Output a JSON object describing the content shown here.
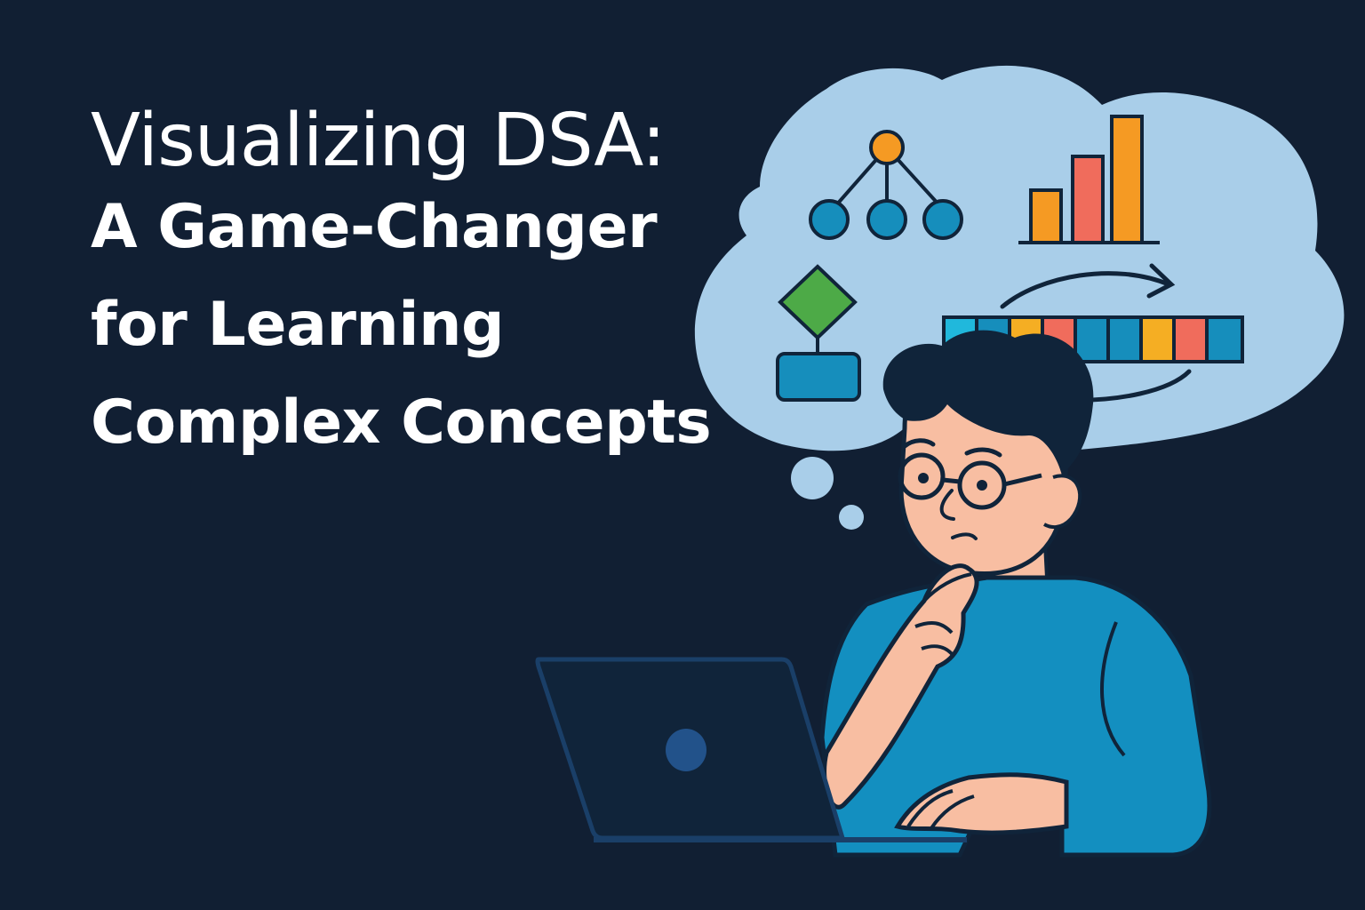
{
  "title": {
    "line1": "Visualizing DSA:",
    "line2": "A Game-Changer",
    "line3": "for Learning",
    "line4": "Complex Concepts"
  },
  "colors": {
    "background": "#111f33",
    "cloud": "#a9cee9",
    "outline": "#10243a",
    "blue": "#168ebc",
    "orange": "#f59a23",
    "coral": "#f06c5c",
    "green": "#4daa47",
    "skin": "#f8bea2",
    "shirt": "#138fc0"
  },
  "icons": [
    "thought-cloud-icon",
    "tree-diagram-icon",
    "bar-chart-icon",
    "flowchart-icon",
    "array-icon",
    "curved-arrow-icon",
    "laptop-icon",
    "student-icon"
  ]
}
